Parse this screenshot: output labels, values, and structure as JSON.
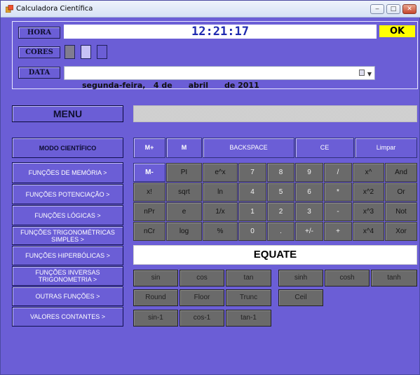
{
  "window": {
    "title": "Calculadora Científica",
    "min_label": "‒",
    "max_label": "□",
    "close_label": "✕"
  },
  "top": {
    "hora_label": "HORA",
    "clock": "12:21:17",
    "ok_label": "OK",
    "cores_label": "CORES",
    "data_label": "DATA",
    "date_value": "segunda-feira,   4 de      abril      de 2011"
  },
  "menu": {
    "label": "MENU",
    "display_value": ""
  },
  "left_menu": {
    "modo": "MODO CIENTÍFICO",
    "items": [
      "FUNÇÕES DE MEMÓRIA >",
      "FUNÇÕES POTENCIAÇÃO >",
      "FUNÇÕES LÓGICAS >",
      "FUNÇÕES TRIGONOMÉTRICAS SIMPLES >",
      "FUNÇÕES HIPERBÓLICAS >",
      "FUNÇÕES INVERSAS TRIGONOMETRIA >",
      "OUTRAS FUNÇÕES >",
      "VALORES CONTANTES >"
    ]
  },
  "top_row": [
    "M+",
    "M",
    "BACKSPACE",
    "CE",
    "Limpar"
  ],
  "keypad": [
    [
      "M-",
      "PI",
      "e^x",
      "7",
      "8",
      "9",
      "/",
      "x^",
      "And"
    ],
    [
      "x!",
      "sqrt",
      "ln",
      "4",
      "5",
      "6",
      "*",
      "x^2",
      "Or"
    ],
    [
      "nPr",
      "e",
      "1/x",
      "1",
      "2",
      "3",
      "-",
      "x^3",
      "Not"
    ],
    [
      "nCr",
      "log",
      "%",
      "0",
      ".",
      "+/-",
      "+",
      "x^4",
      "Xor"
    ]
  ],
  "equate_label": "EQUATE",
  "functions": {
    "trig": [
      "sin",
      "cos",
      "tan"
    ],
    "hyper": [
      "sinh",
      "cosh",
      "tanh"
    ],
    "other": [
      "Round",
      "Floor",
      "Trunc"
    ],
    "ceil": "Ceil",
    "inverse": [
      "sin-1",
      "cos-1",
      "tan-1"
    ]
  },
  "colors": {
    "background": "#6b5ed6",
    "clock_text": "#1f2ab0",
    "ok_button": "#ffff00",
    "key_gray": "#6a6a6a",
    "swatches": [
      "#807c90",
      "#c7c2f5",
      "#6b5ed6"
    ]
  }
}
